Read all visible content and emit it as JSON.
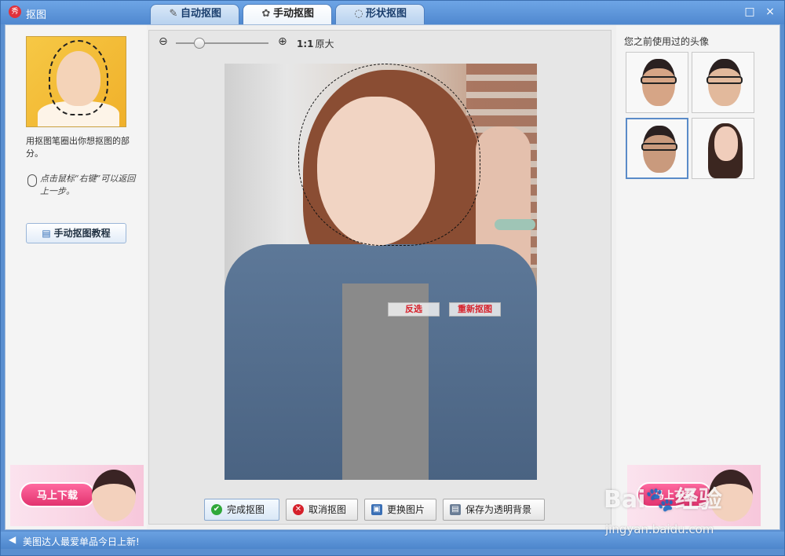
{
  "window": {
    "title": "抠图",
    "app_icon": "秀",
    "maximize_icon": "□",
    "close_icon": "×"
  },
  "tabs": [
    {
      "label": "自动抠图",
      "icon": "brush-icon",
      "glyph": "✎",
      "active": false
    },
    {
      "label": "手动抠图",
      "icon": "hand-icon",
      "glyph": "✿",
      "active": true
    },
    {
      "label": "形状抠图",
      "icon": "shape-icon",
      "glyph": "◌",
      "active": false
    }
  ],
  "left_panel": {
    "hint_primary": "用抠图笔圈出你想抠图的部分。",
    "hint_secondary": "点击鼠标“右键”可以返回上一步。",
    "tutorial_button": "手动抠图教程"
  },
  "ads": {
    "download_label": "马上下载"
  },
  "toolbar": {
    "zoom_out_icon": "⊖",
    "zoom_in_icon": "⊕",
    "ratio_bold": "1:1",
    "ratio_label": "原大",
    "zoom_level": 0.25
  },
  "canvas": {
    "invert_label": "反选",
    "redo_label": "重新抠图"
  },
  "actions": {
    "done": "完成抠图",
    "cancel": "取消抠图",
    "replace": "更换图片",
    "save": "保存为透明背景"
  },
  "right_panel": {
    "recent_label": "您之前使用过的头像"
  },
  "statusbar": {
    "text": "美图达人最爱单品今日上新!"
  },
  "watermark": {
    "brand": "Bai🐾经验",
    "url": "jingyan.baidu.com"
  },
  "colors": {
    "accent": "#4f88cf",
    "danger": "#d6202a",
    "download": "#e2336f"
  }
}
